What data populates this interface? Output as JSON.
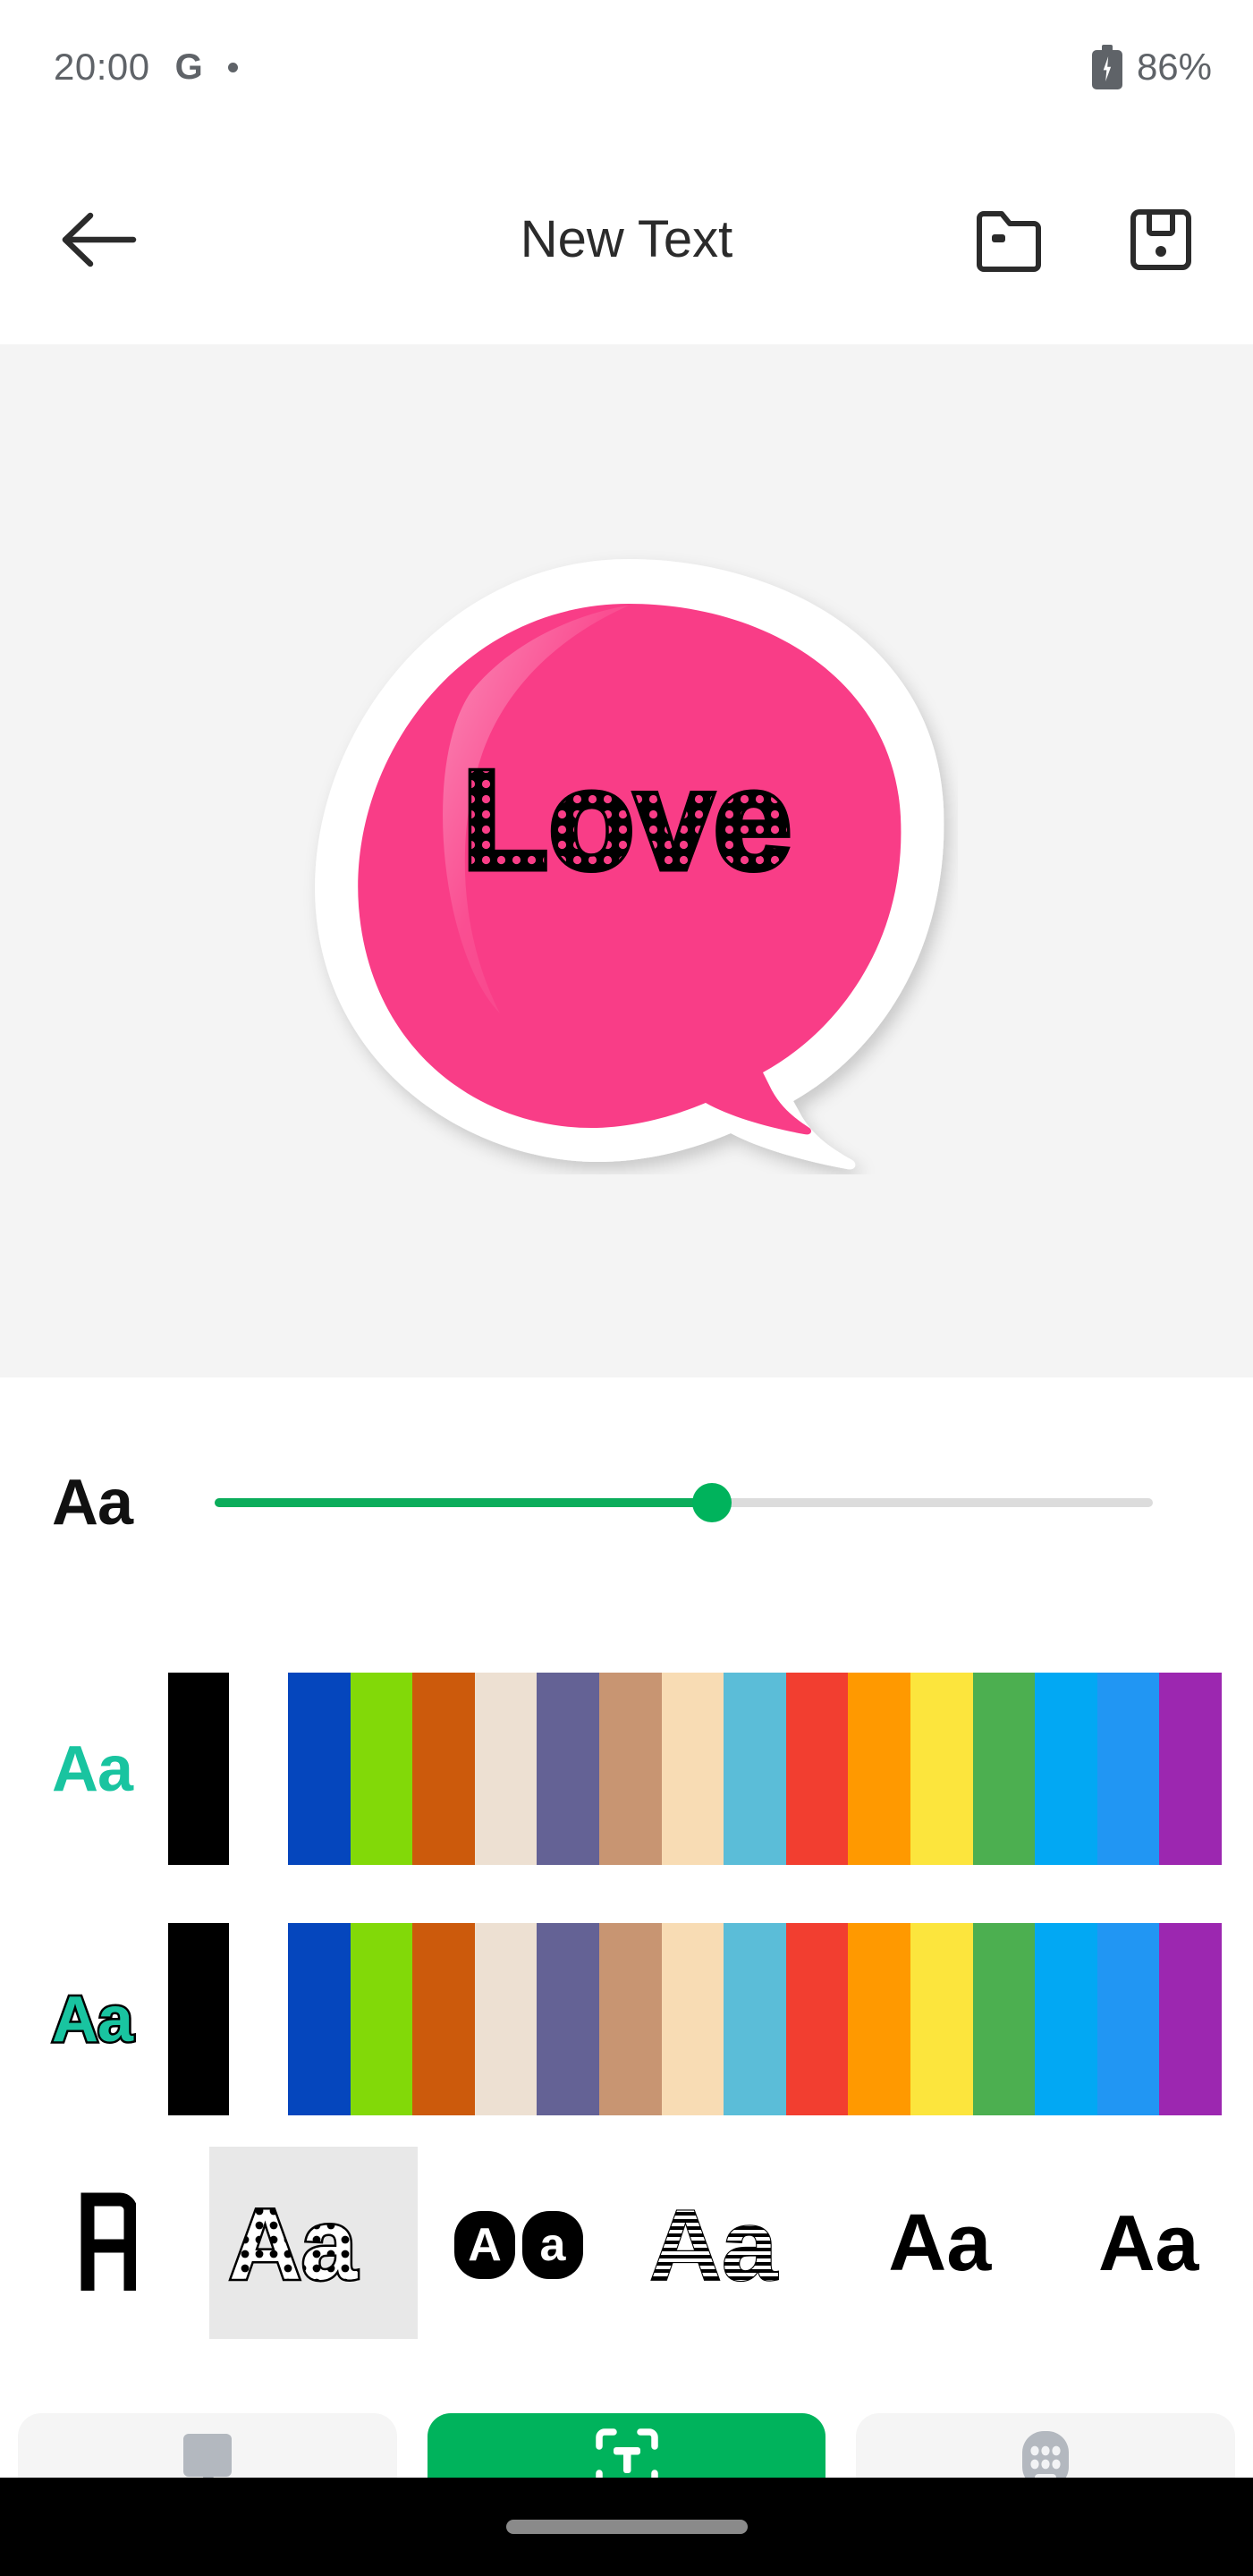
{
  "status_bar": {
    "time": "20:00",
    "google_icon": "G",
    "notification_dot_icon": "dot-icon",
    "battery_icon": "battery-charging-icon",
    "battery_percent": "86%"
  },
  "app_bar": {
    "back_icon": "back-arrow-icon",
    "title": "New Text",
    "open_icon": "folder-open-icon",
    "save_icon": "floppy-save-icon"
  },
  "canvas": {
    "background_color": "#f4f4f4",
    "sticker": {
      "shape": "speech-bubble",
      "fill_color": "#F93D87",
      "border_color": "#ffffff",
      "text": "Love",
      "text_color": "#000000",
      "text_style": "polka-dot"
    }
  },
  "size_slider": {
    "label": "Aa",
    "value_percent": 53,
    "fill_color": "#0bad5b",
    "track_color": "#dcdcdc",
    "thumb_color": "#00b35c"
  },
  "color_rows": [
    {
      "id": "fill-color-row",
      "label": "Aa",
      "label_style": "fill",
      "label_color": "#19c4a0",
      "black_swatch": "#000000",
      "swatches": [
        "#0546BD",
        "#82D908",
        "#CC5A0C",
        "#EDE0D2",
        "#646295",
        "#C89572",
        "#F8DCB4",
        "#5BBDD8",
        "#F23E30",
        "#FF9900",
        "#FCE53D",
        "#4CAF50",
        "#02A8F3",
        "#2196F3",
        "#9C27B0"
      ]
    },
    {
      "id": "stroke-color-row",
      "label": "Aa",
      "label_style": "stroke",
      "label_color": "#19c4a0",
      "black_swatch": "#000000",
      "swatches": [
        "#0546BD",
        "#82D908",
        "#CC5A0C",
        "#EDE0D2",
        "#646295",
        "#C89572",
        "#F8DCB4",
        "#5BBDD8",
        "#F23E30",
        "#FF9900",
        "#FCE53D",
        "#4CAF50",
        "#02A8F3",
        "#2196F3",
        "#9C27B0"
      ]
    }
  ],
  "font_styles": {
    "selected_index": 1,
    "items": [
      {
        "name": "font-style-outline-a",
        "sample": "A",
        "style": "outline-block"
      },
      {
        "name": "font-style-polka-dot",
        "sample": "Aa",
        "style": "polka-dot"
      },
      {
        "name": "font-style-rounded-block",
        "sample": "Aa",
        "style": "rounded-knockout"
      },
      {
        "name": "font-style-striped",
        "sample": "Aa",
        "style": "striped-lines"
      },
      {
        "name": "font-style-bold-1",
        "sample": "Aa",
        "style": "bold-solid"
      },
      {
        "name": "font-style-bold-2",
        "sample": "Aa",
        "style": "bold-solid"
      }
    ]
  },
  "bottom_toolbar": {
    "items": [
      {
        "name": "bubble-tool-button",
        "icon": "speech-bubble-icon",
        "active": false
      },
      {
        "name": "text-tool-button",
        "icon": "text-frame-icon",
        "active": true
      },
      {
        "name": "keyboard-tool-button",
        "icon": "keyboard-icon",
        "active": false
      }
    ],
    "active_color": "#00b35c",
    "inactive_color": "#f5f5f5"
  },
  "gesture_bar": {
    "pill_color": "#8a8a8a",
    "background": "#000000"
  }
}
